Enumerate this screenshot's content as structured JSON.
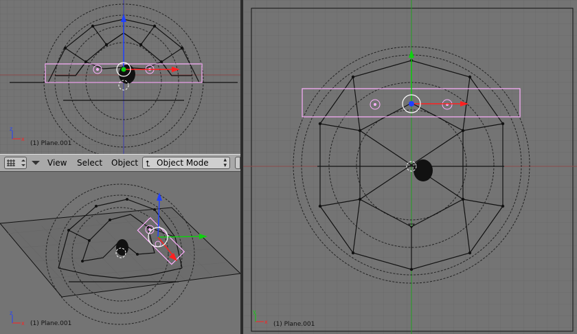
{
  "viewports": {
    "front": {
      "label": "(1) Plane.001"
    },
    "perspective": {
      "label": "(1) Plane.001"
    },
    "top": {
      "label": "(1) Plane.001"
    }
  },
  "header": {
    "menus": {
      "view": "View",
      "select": "Select",
      "object": "Object"
    },
    "mode": {
      "label": "Object Mode"
    }
  },
  "icons": {
    "window_type": "grid-icon",
    "menu_toggle": "triangle-down-icon",
    "mode": "object-mode-icon"
  },
  "colors": {
    "viewport_bg": "#747474",
    "header_bg": "#a9a9a9",
    "selection": "#ffb0ff",
    "axis_x": "#ff2020",
    "axis_y": "#10d010",
    "axis_z": "#2040ff"
  }
}
